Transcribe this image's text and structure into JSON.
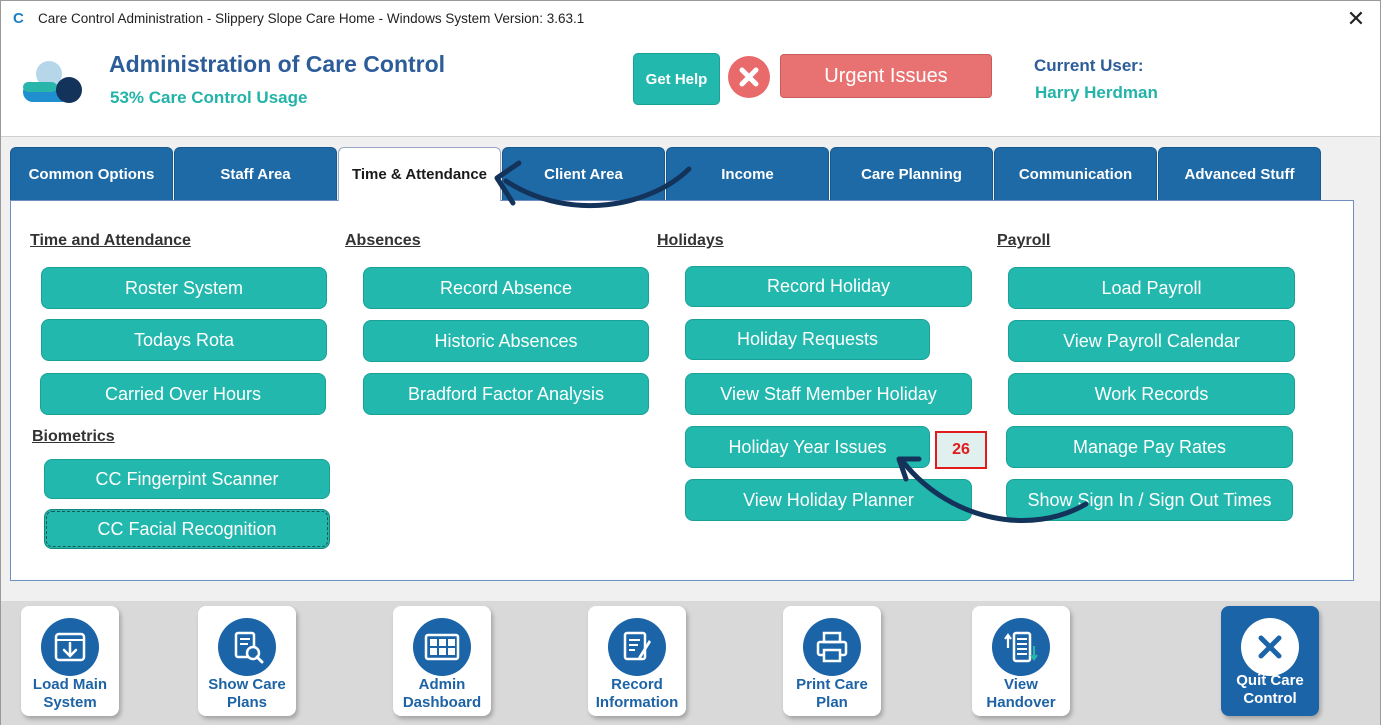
{
  "window": {
    "title": "Care Control Administration - Slippery Slope Care Home - Windows System Version: 3.63.1",
    "close_glyph": "✕"
  },
  "header": {
    "title": "Administration of Care Control",
    "usage": "53% Care Control Usage",
    "help_label": "Get Help",
    "urgent_label": "Urgent Issues",
    "current_user_label": "Current User:",
    "current_user_name": "Harry Herdman"
  },
  "tabs": [
    {
      "label": "Common Options",
      "active": false
    },
    {
      "label": "Staff Area",
      "active": false
    },
    {
      "label": "Time & Attendance",
      "active": true
    },
    {
      "label": "Client Area",
      "active": false
    },
    {
      "label": "Income",
      "active": false
    },
    {
      "label": "Care Planning",
      "active": false
    },
    {
      "label": "Communication",
      "active": false
    },
    {
      "label": "Advanced Stuff",
      "active": false
    }
  ],
  "sections": {
    "time_attendance": {
      "title": "Time and Attendance",
      "buttons": [
        "Roster System",
        "Todays Rota",
        "Carried Over Hours"
      ]
    },
    "biometrics": {
      "title": "Biometrics",
      "buttons": [
        "CC Fingerpint Scanner",
        "CC Facial Recognition"
      ]
    },
    "absences": {
      "title": "Absences",
      "buttons": [
        "Record Absence",
        "Historic Absences",
        "Bradford Factor Analysis"
      ]
    },
    "holidays": {
      "title": "Holidays",
      "buttons": [
        "Record Holiday",
        "Holiday Requests",
        "View Staff Member Holiday",
        "Holiday Year Issues",
        "View Holiday Planner"
      ],
      "issues_count": "26"
    },
    "payroll": {
      "title": "Payroll",
      "buttons": [
        "Load Payroll",
        "View Payroll Calendar",
        "Work Records",
        "Manage Pay Rates",
        "Show Sign In / Sign Out Times"
      ]
    }
  },
  "toolbar": [
    {
      "line1": "Load Main",
      "line2": "System",
      "icon": "download-icon"
    },
    {
      "line1": "Show Care",
      "line2": "Plans",
      "icon": "document-search-icon"
    },
    {
      "line1": "Admin",
      "line2": "Dashboard",
      "icon": "dashboard-icon"
    },
    {
      "line1": "Record",
      "line2": "Information",
      "icon": "edit-document-icon"
    },
    {
      "line1": "Print Care",
      "line2": "Plan",
      "icon": "printer-icon"
    },
    {
      "line1": "View",
      "line2": "Handover",
      "icon": "handover-list-icon"
    },
    {
      "line1": "Quit Care",
      "line2": "Control",
      "icon": "close-icon"
    }
  ],
  "colors": {
    "brand_blue": "#1e6aa6",
    "teal": "#22b8ae",
    "urgent_red": "#e87272",
    "title_blue": "#2d5d99"
  }
}
